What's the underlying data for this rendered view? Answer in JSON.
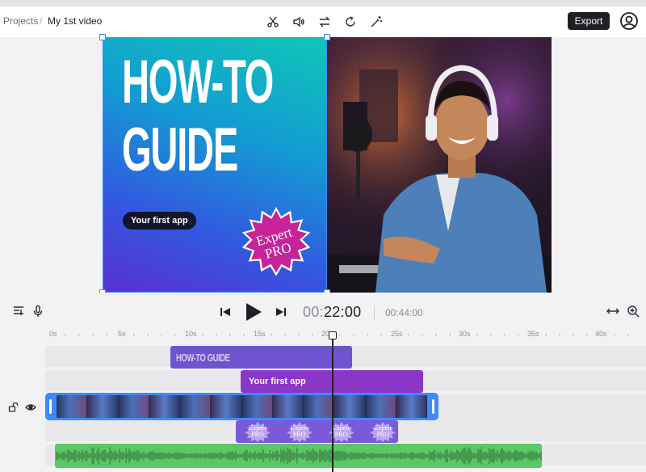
{
  "breadcrumb": {
    "projects": "Projects",
    "separator": "/",
    "title": "My 1st video"
  },
  "toolbar": {
    "tools": [
      "scissors-icon",
      "volume-icon",
      "swap-icon",
      "rotate-icon",
      "magic-wand-icon"
    ],
    "export_label": "Export",
    "account_icon": "user-circle-icon"
  },
  "canvas": {
    "graphic": {
      "headline_line1": "HOW-TO",
      "headline_line2": "GUIDE",
      "pill": "Your first app",
      "sticker_line1": "Expert",
      "sticker_line2": "PRO",
      "gradient": [
        "#0fc7b6",
        "#139bd3",
        "#3357e0",
        "#5a2fd0"
      ]
    },
    "selection_color": "#3d8bff"
  },
  "player": {
    "current_time_prefix": "00:",
    "current_time_main": "22:00",
    "duration": "00:44:00",
    "icons": [
      "caption-icon",
      "microphone-icon",
      "skip-back-icon",
      "play-icon",
      "skip-forward-icon",
      "fit-width-icon",
      "zoom-in-icon"
    ]
  },
  "timeline": {
    "ruler": [
      "0s",
      "5s",
      "10s",
      "15s",
      "20s",
      "25s",
      "30s",
      "35s",
      "40s"
    ],
    "playhead_time_s": 22,
    "tracks": {
      "text_clip_1": "HOW-TO GUIDE",
      "text_clip_2": "Your first app",
      "sticker_clip": [
        "Expert PRO",
        "Expert PRO",
        "Expert PRO",
        "Expert PRO"
      ],
      "track_icons": [
        "unlock-icon",
        "eye-icon"
      ]
    },
    "colors": {
      "text1": "#6d55cf",
      "text2": "#8a36c6",
      "video": "#3d8bff",
      "stickers": "#7a5ad8",
      "audio": "#5cc766"
    }
  }
}
